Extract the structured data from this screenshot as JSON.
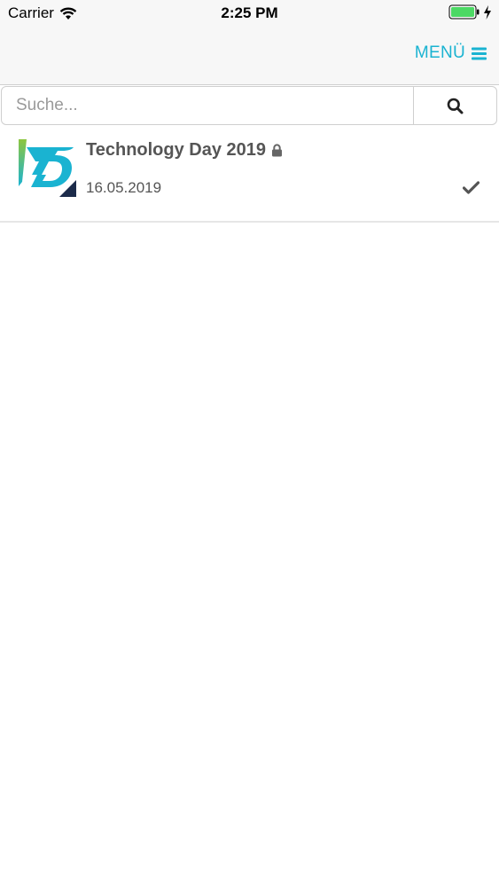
{
  "status_bar": {
    "carrier": "Carrier",
    "time": "2:25 PM",
    "icons": [
      "wifi-icon",
      "battery-icon",
      "charging-bolt-icon"
    ]
  },
  "navbar": {
    "menu_label": "MENÜ",
    "menu_icon": "hamburger-icon",
    "accent_color": "#1ab3d1"
  },
  "search": {
    "placeholder": "Suche...",
    "value": "",
    "button_icon": "search-icon"
  },
  "events": [
    {
      "title": "Technology Day 2019",
      "date": "16.05.2019",
      "locked": true,
      "selected": true,
      "logo": "td-logo"
    }
  ]
}
